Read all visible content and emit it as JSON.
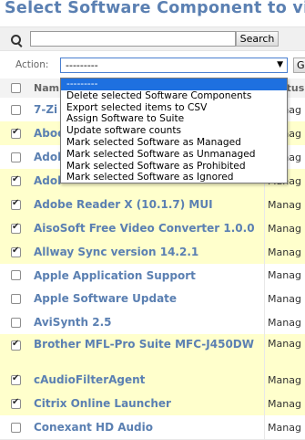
{
  "page": {
    "title": "Select Software Component to vi"
  },
  "search": {
    "value": "",
    "button_label": "Search"
  },
  "action": {
    "label": "Action:",
    "selected": "---------",
    "go_label": "G"
  },
  "columns": {
    "name": "Nam",
    "status": "Status"
  },
  "dropdown_options": [
    "---------",
    "Delete selected Software Components",
    "Export selected items to CSV",
    "Assign Software to Suite",
    "Update software counts",
    "Mark selected Software as Managed",
    "Mark selected Software as Unmanaged",
    "Mark selected Software as Prohibited",
    "Mark selected Software as Ignored"
  ],
  "rows": [
    {
      "name": "7-Zi",
      "status": "Manag",
      "checked": false
    },
    {
      "name": "Aboo",
      "status": "Manag",
      "checked": true
    },
    {
      "name": "Adol",
      "status": "Manag",
      "checked": false
    },
    {
      "name": "Adol",
      "status": "Manag",
      "checked": true
    },
    {
      "name": "Adobe Reader X (10.1.7) MUI",
      "status": "Manag",
      "checked": true
    },
    {
      "name": "AisoSoft Free Video Converter 1.0.0",
      "status": "Manag",
      "checked": true
    },
    {
      "name": "Allway Sync version 14.2.1",
      "status": "Manag",
      "checked": true
    },
    {
      "name": "Apple Application Support",
      "status": "Manag",
      "checked": false
    },
    {
      "name": "Apple Software Update",
      "status": "Manag",
      "checked": false
    },
    {
      "name": "AviSynth 2.5",
      "status": "Manag",
      "checked": false
    },
    {
      "name": "Brother MFL-Pro Suite MFC-J450DW",
      "status": "Manag",
      "checked": true
    },
    {
      "name": "cAudioFilterAgent",
      "status": "Manag",
      "checked": true
    },
    {
      "name": "Citrix Online Launcher",
      "status": "Manag",
      "checked": true
    },
    {
      "name": "Conexant HD Audio",
      "status": "Manag",
      "checked": false
    }
  ]
}
